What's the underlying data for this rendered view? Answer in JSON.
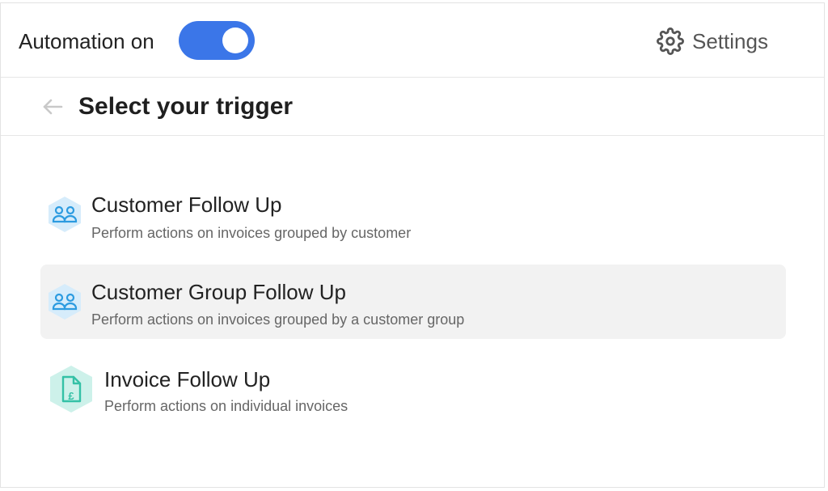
{
  "header": {
    "automation_label": "Automation on",
    "automation_enabled": true,
    "accent_color": "#3b76e8",
    "settings_label": "Settings",
    "settings_icon": "gear-icon"
  },
  "subheader": {
    "back_icon": "arrow-left-icon",
    "title": "Select your trigger"
  },
  "triggers": [
    {
      "title": "Customer Follow Up",
      "description": "Perform actions on invoices grouped by customer",
      "icon": "customer-group-icon",
      "selected": false
    },
    {
      "title": "Customer Group Follow Up",
      "description": "Perform actions on invoices grouped by a customer group",
      "icon": "customer-group-icon",
      "selected": true
    },
    {
      "title": "Invoice Follow Up",
      "description": "Perform actions on individual invoices",
      "icon": "invoice-pound-icon",
      "selected": false
    }
  ]
}
